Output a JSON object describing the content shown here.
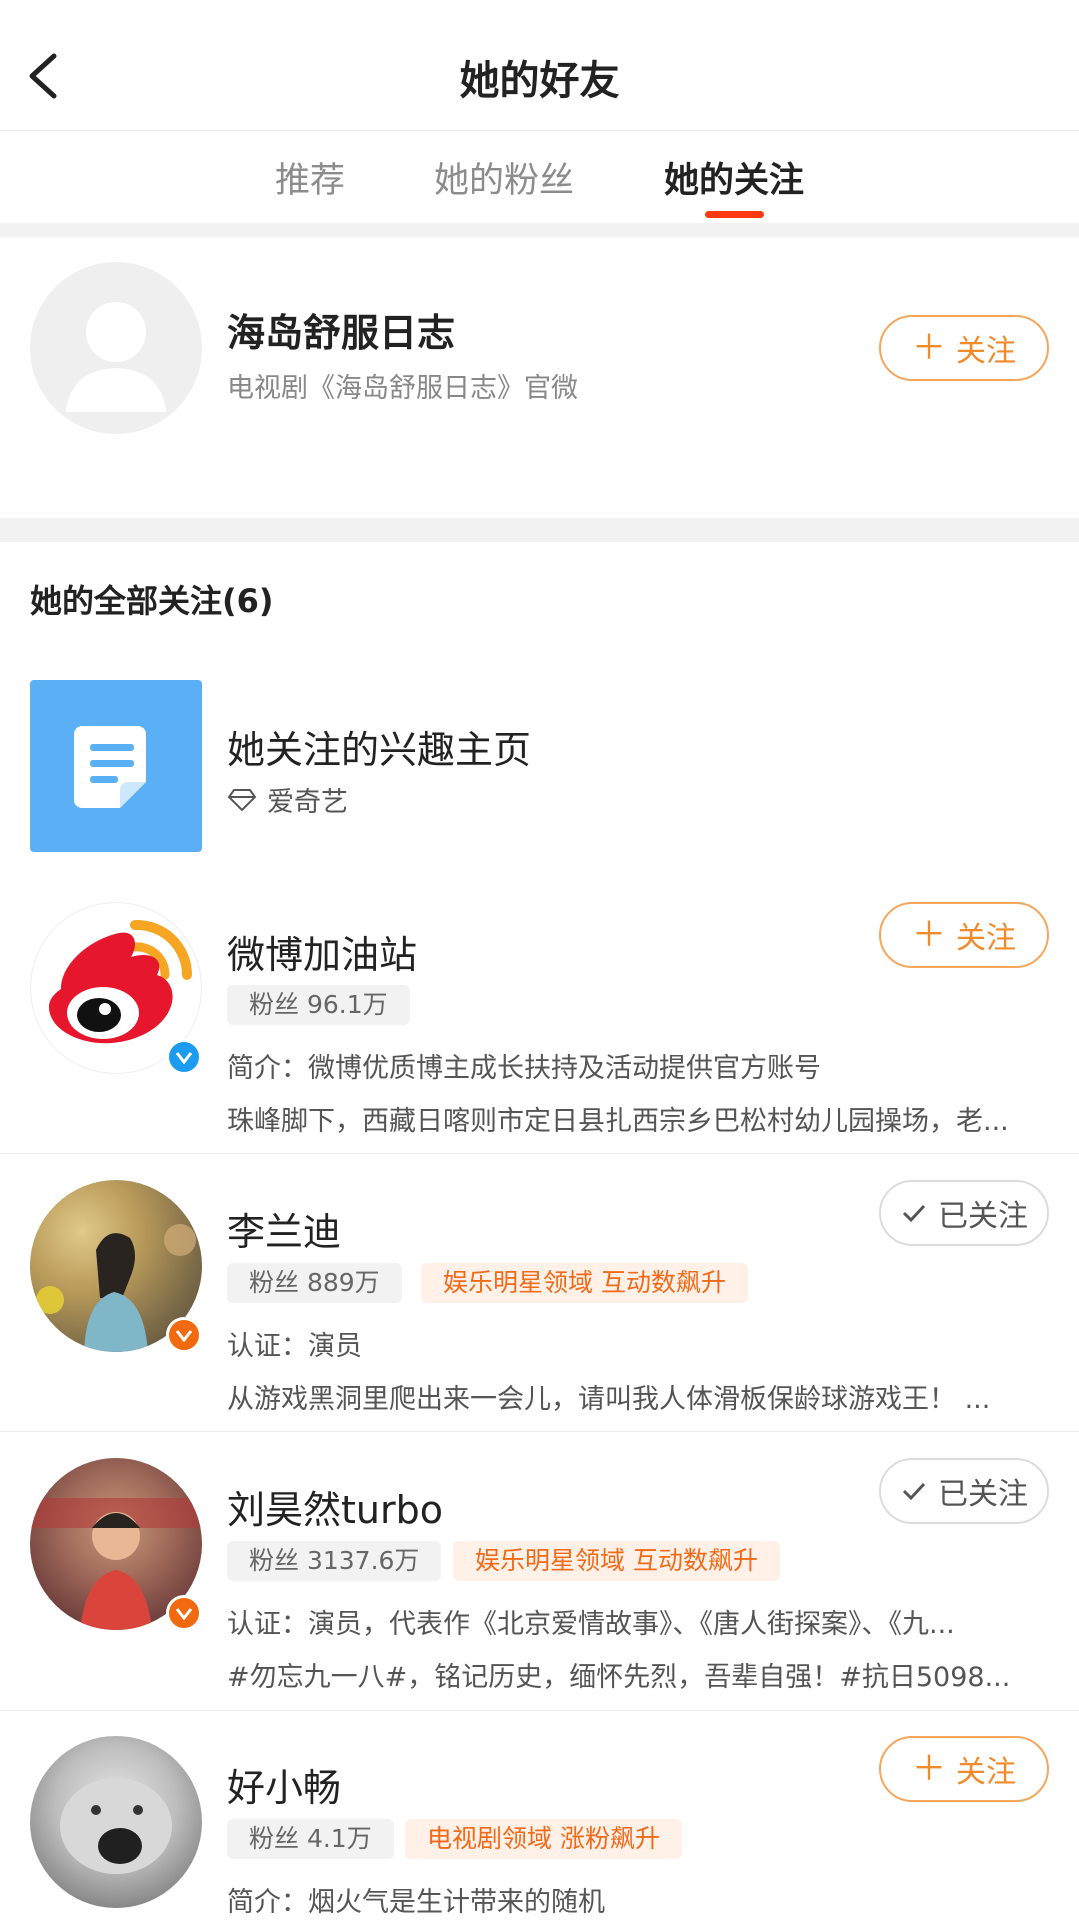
{
  "header": {
    "title": "她的好友",
    "back_icon": "chevron-left-icon"
  },
  "tabs": [
    {
      "label": "推荐",
      "active": false
    },
    {
      "label": "她的粉丝",
      "active": false
    },
    {
      "label": "她的关注",
      "active": true
    }
  ],
  "recommend": {
    "name": "海岛舒服日志",
    "desc": "电视剧《海岛舒服日志》官微",
    "button": "关注"
  },
  "section_title": "她的全部关注(6)",
  "interest": {
    "name": "她关注的兴趣主页",
    "sub": "爱奇艺"
  },
  "list": [
    {
      "name": "微博加油站",
      "fans": "粉丝 96.1万",
      "tag": "",
      "line1": "简介：微博优质博主成长扶持及活动提供官方账号",
      "line2": "珠峰脚下，西藏日喀则市定日县扎西宗乡巴松村幼儿园操场，老...",
      "button": "关注",
      "followed": false,
      "badge": "blue"
    },
    {
      "name": "李兰迪",
      "fans": "粉丝 889万",
      "tag": "娱乐明星领域 互动数飙升",
      "line1": "认证：演员",
      "line2": "从游戏黑洞里爬出来一会儿，请叫我人体滑板保龄球游戏王！ ...",
      "button": "已关注",
      "followed": true,
      "badge": "orange"
    },
    {
      "name": "刘昊然turbo",
      "fans": "粉丝 3137.6万",
      "tag": "娱乐明星领域 互动数飙升",
      "line1": "认证：演员，代表作《北京爱情故事》、《唐人街探案》、《九...",
      "line2": "#勿忘九一八#，铭记历史，缅怀先烈，吾辈自强！#抗日5098...",
      "button": "已关注",
      "followed": true,
      "badge": "orange"
    },
    {
      "name": "好小畅",
      "fans": "粉丝 4.1万",
      "tag": "电视剧领域 涨粉飙升",
      "line1": "简介：烟火气是生计带来的随机",
      "line2": "",
      "button": "关注",
      "followed": false,
      "badge": ""
    }
  ],
  "colors": {
    "accent": "#f08a2a",
    "tab_underline": "#ff3a10",
    "verified_blue": "#1d9bf0",
    "verified_orange": "#f26a0f"
  }
}
